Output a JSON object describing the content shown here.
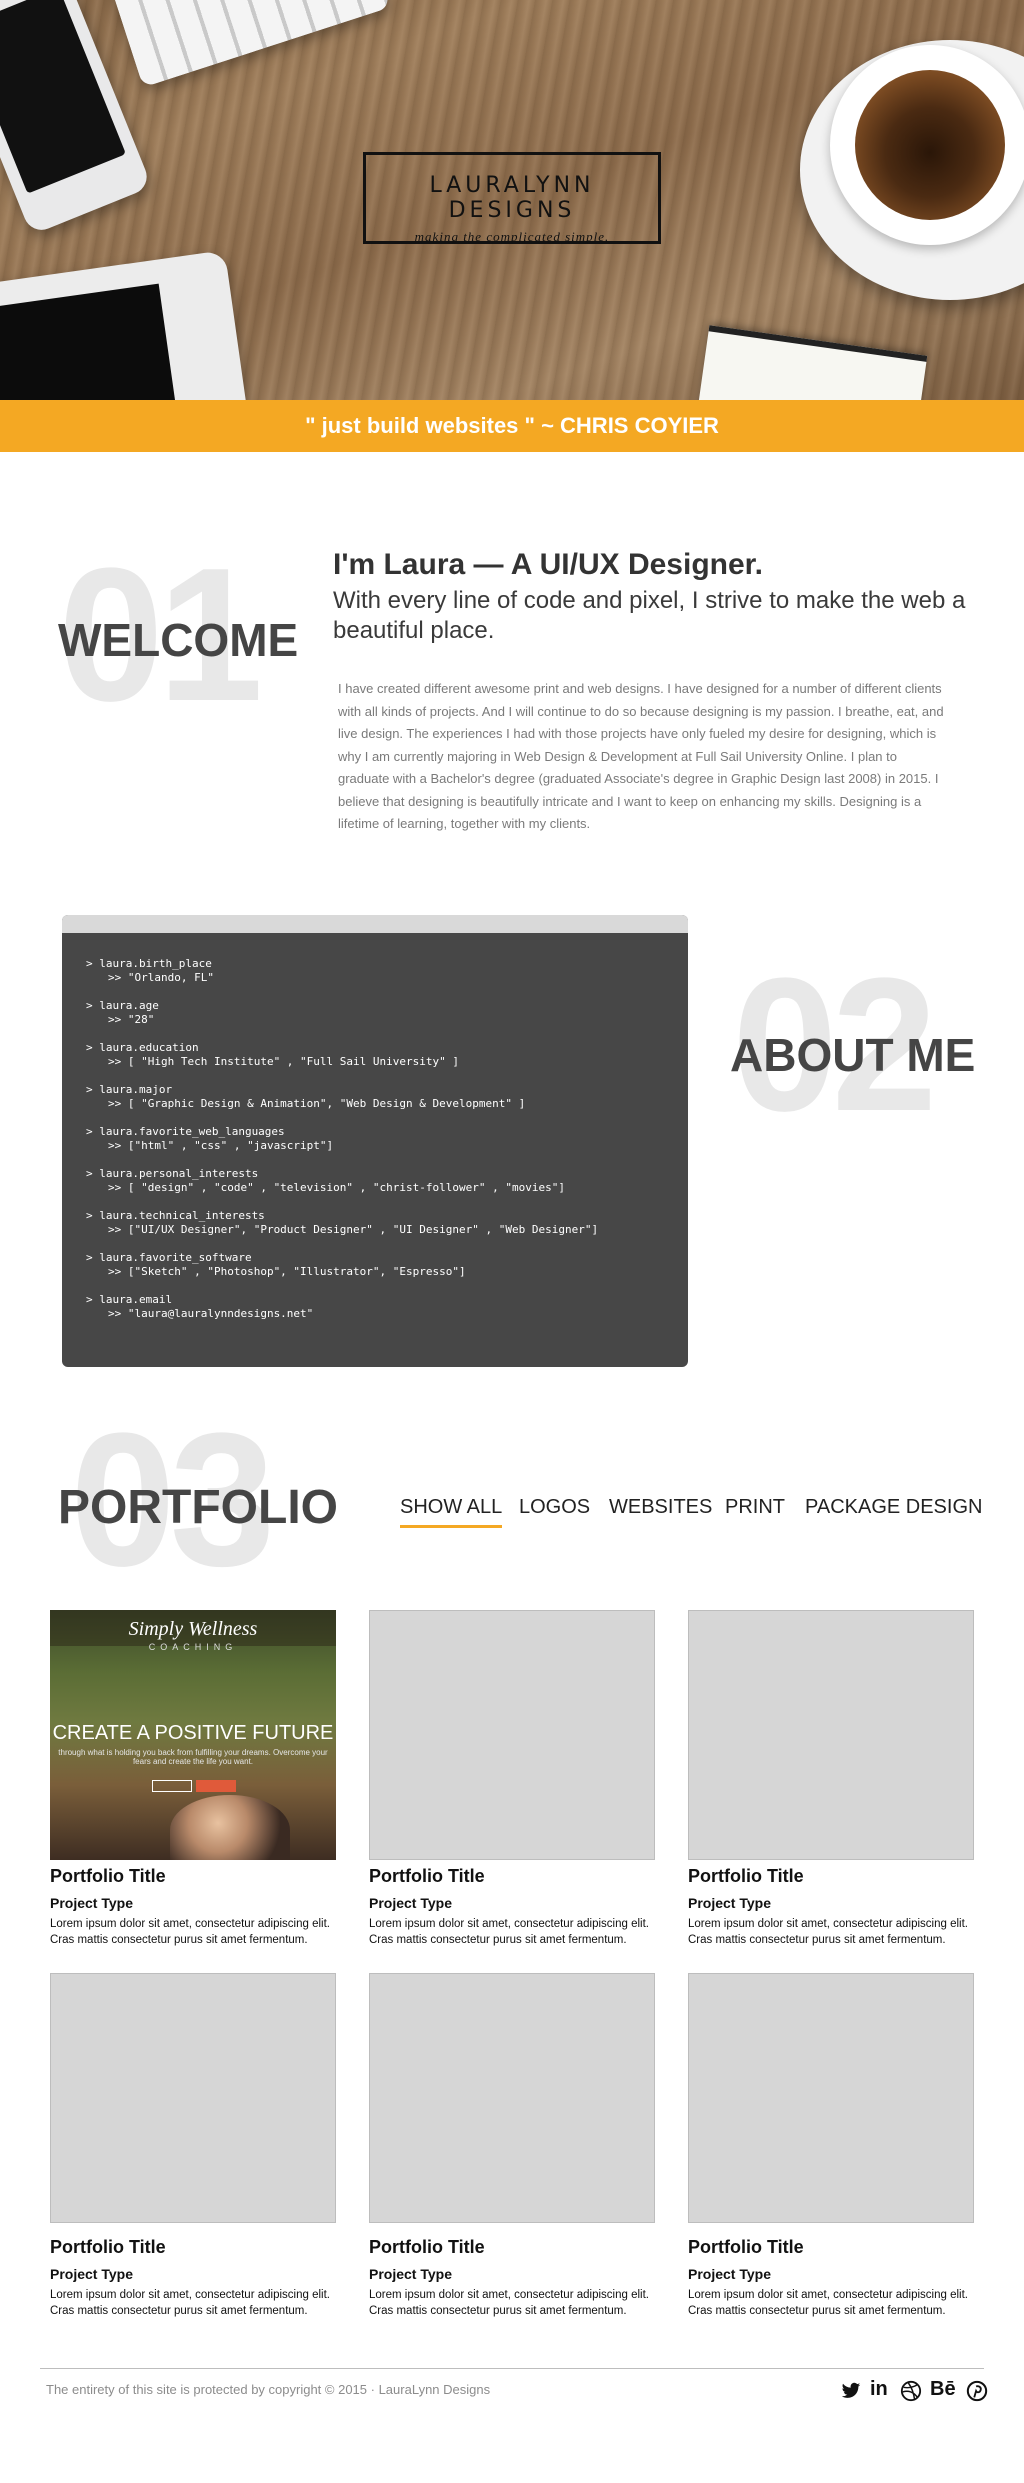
{
  "hero": {
    "logo_title": "LAURALYNN DESIGNS",
    "logo_tagline": "making the complicated simple."
  },
  "quote": "\" just build websites \" ~ CHRIS COYIER",
  "welcome": {
    "number": "01",
    "title": "WELCOME",
    "heading": "I'm Laura — A UI/UX Designer.",
    "subheading": "With every line of code and pixel, I strive to make the web a beautiful place.",
    "body": "I have created different awesome print and web designs. I have designed for a number of different clients with all kinds of projects. And I will continue to do so because designing is my passion. I breathe, eat, and live design. The experiences I had with those projects have only fueled my desire for designing, which is why I am currently majoring in Web Design & Development at Full Sail University Online. I plan to graduate with a Bachelor's degree (graduated Associate's degree in Graphic Design last 2008) in 2015. I believe that designing is beautifully intricate and I want to keep on enhancing my skills. Designing is a lifetime of learning, together with my clients."
  },
  "about": {
    "number": "02",
    "title": "ABOUT ME",
    "terminal": [
      {
        "key": "> laura.birth_place",
        "value": ">> \"Orlando, FL\""
      },
      {
        "key": "> laura.age",
        "value": ">> \"28\""
      },
      {
        "key": "> laura.education",
        "value": ">> [ \"High Tech Institute\" , \"Full Sail University\" ]"
      },
      {
        "key": "> laura.major",
        "value": ">> [ \"Graphic Design & Animation\", \"Web Design & Development\" ]"
      },
      {
        "key": "> laura.favorite_web_languages",
        "value": ">> [\"html\" , \"css\" , \"javascript\"]"
      },
      {
        "key": "> laura.personal_interests",
        "value": ">> [ \"design\" , \"code\" , \"television\" , \"christ-follower\" , \"movies\"]"
      },
      {
        "key": "> laura.technical_interests",
        "value": ">> [\"UI/UX Designer\", \"Product Designer\" , \"UI Designer\" , \"Web Designer\"]"
      },
      {
        "key": "> laura.favorite_software",
        "value": ">> [\"Sketch\" , \"Photoshop\", \"Illustrator\", \"Espresso\"]"
      },
      {
        "key": "> laura.email",
        "value": ">> \"laura@lauralynndesigns.net\""
      }
    ]
  },
  "portfolio": {
    "number": "03",
    "title": "PORTFOLIO",
    "filters": [
      "SHOW ALL",
      "LOGOS",
      "WEBSITES",
      "PRINT",
      "PACKAGE DESIGN"
    ],
    "active_filter": "SHOW ALL",
    "featured_thumb": {
      "brand": "Simply Wellness",
      "brand_sub": "COACHING",
      "headline": "CREATE A POSITIVE FUTURE",
      "tagline": "through what is holding you back from fulfilling your dreams. Overcome your fears and create the life you want."
    },
    "items": [
      {
        "title": "Portfolio Title",
        "type": "Project Type",
        "desc": "Lorem ipsum dolor sit amet, consectetur adipiscing elit. Cras mattis consectetur purus sit amet fermentum."
      },
      {
        "title": "Portfolio Title",
        "type": "Project Type",
        "desc": "Lorem ipsum dolor sit amet, consectetur adipiscing elit. Cras mattis consectetur purus sit amet fermentum."
      },
      {
        "title": "Portfolio Title",
        "type": "Project Type",
        "desc": "Lorem ipsum dolor sit amet, consectetur adipiscing elit. Cras mattis consectetur purus sit amet fermentum."
      },
      {
        "title": "Portfolio Title",
        "type": "Project Type",
        "desc": "Lorem ipsum dolor sit amet, consectetur adipiscing elit. Cras mattis consectetur purus sit amet fermentum."
      },
      {
        "title": "Portfolio Title",
        "type": "Project Type",
        "desc": "Lorem ipsum dolor sit amet, consectetur adipiscing elit. Cras mattis consectetur purus sit amet fermentum."
      },
      {
        "title": "Portfolio Title",
        "type": "Project Type",
        "desc": "Lorem ipsum dolor sit amet, consectetur adipiscing elit. Cras mattis consectetur purus sit amet fermentum."
      }
    ]
  },
  "footer": {
    "copyright": "The entirety of this site is protected by copyright © 2015 · LauraLynn Designs",
    "social": [
      {
        "name": "twitter-icon",
        "glyph": "🐦"
      },
      {
        "name": "linkedin-icon",
        "glyph": "in"
      },
      {
        "name": "dribbble-icon",
        "glyph": "◍"
      },
      {
        "name": "behance-icon",
        "glyph": "Bē"
      },
      {
        "name": "pinterest-icon",
        "glyph": "℗"
      }
    ]
  },
  "colors": {
    "accent": "#f4a823",
    "terminal_bg": "#474747",
    "number_gray": "#e8e8e8",
    "title_gray": "#454545"
  }
}
